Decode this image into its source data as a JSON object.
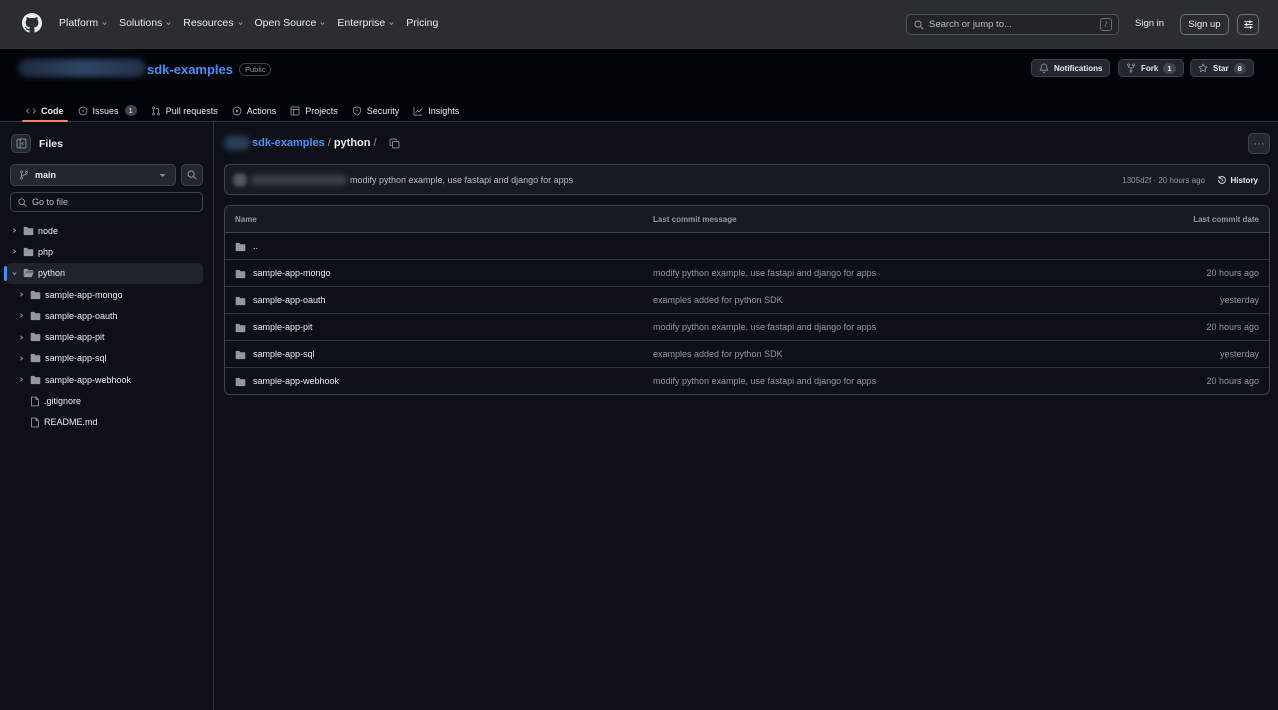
{
  "nav": {
    "items": [
      {
        "label": "Platform",
        "dropdown": true
      },
      {
        "label": "Solutions",
        "dropdown": true
      },
      {
        "label": "Resources",
        "dropdown": true
      },
      {
        "label": "Open Source",
        "dropdown": true
      },
      {
        "label": "Enterprise",
        "dropdown": true
      },
      {
        "label": "Pricing",
        "dropdown": false
      }
    ],
    "search_placeholder": "Search or jump to...",
    "search_shortcut": "/",
    "sign_in": "Sign in",
    "sign_up": "Sign up"
  },
  "repo": {
    "name": "sdk-examples",
    "visibility": "Public",
    "notifications_label": "Notifications",
    "fork_label": "Fork",
    "fork_count": "1",
    "star_label": "Star",
    "star_count": "8"
  },
  "tabs": [
    {
      "label": "Code",
      "icon": "code-icon",
      "badge": ""
    },
    {
      "label": "Issues",
      "icon": "issue-icon",
      "badge": "1"
    },
    {
      "label": "Pull requests",
      "icon": "pull-request-icon",
      "badge": ""
    },
    {
      "label": "Actions",
      "icon": "play-icon",
      "badge": ""
    },
    {
      "label": "Projects",
      "icon": "table-icon",
      "badge": ""
    },
    {
      "label": "Security",
      "icon": "shield-icon",
      "badge": ""
    },
    {
      "label": "Insights",
      "icon": "graph-icon",
      "badge": ""
    }
  ],
  "sidebar": {
    "title": "Files",
    "branch": "main",
    "goto_placeholder": "Go to file",
    "tree": [
      {
        "label": "node",
        "type": "folder",
        "depth": 0,
        "expanded": false
      },
      {
        "label": "php",
        "type": "folder",
        "depth": 0,
        "expanded": false
      },
      {
        "label": "python",
        "type": "folder",
        "depth": 0,
        "expanded": true,
        "selected": true
      },
      {
        "label": "sample-app-mongo",
        "type": "folder",
        "depth": 1,
        "expanded": false
      },
      {
        "label": "sample-app-oauth",
        "type": "folder",
        "depth": 1,
        "expanded": false
      },
      {
        "label": "sample-app-pit",
        "type": "folder",
        "depth": 1,
        "expanded": false
      },
      {
        "label": "sample-app-sql",
        "type": "folder",
        "depth": 1,
        "expanded": false
      },
      {
        "label": "sample-app-webhook",
        "type": "folder",
        "depth": 1,
        "expanded": false
      },
      {
        "label": ".gitignore",
        "type": "file",
        "depth": 1
      },
      {
        "label": "README.md",
        "type": "file",
        "depth": 1
      }
    ]
  },
  "breadcrumb": {
    "repo": "sdk-examples",
    "sep": "/",
    "dir": "python"
  },
  "commit": {
    "message": "modify python example, use fastapi and django for apps",
    "hash_time": "1305d2f · 20 hours ago",
    "history_label": "History"
  },
  "table": {
    "headers": {
      "name": "Name",
      "message": "Last commit message",
      "date": "Last commit date"
    },
    "rows": [
      {
        "name": "..",
        "message": "",
        "date": ""
      },
      {
        "name": "sample-app-mongo",
        "message": "modify python example, use fastapi and django for apps",
        "date": "20 hours ago"
      },
      {
        "name": "sample-app-oauth",
        "message": "examples added for python SDK",
        "date": "yesterday"
      },
      {
        "name": "sample-app-pit",
        "message": "modify python example, use fastapi and django for apps",
        "date": "20 hours ago"
      },
      {
        "name": "sample-app-sql",
        "message": "examples added for python SDK",
        "date": "yesterday"
      },
      {
        "name": "sample-app-webhook",
        "message": "modify python example, use fastapi and django for apps",
        "date": "20 hours ago"
      }
    ]
  },
  "colors": {
    "accent": "#4493f8",
    "tab_underline": "#f78166",
    "background": "#0d1117"
  }
}
